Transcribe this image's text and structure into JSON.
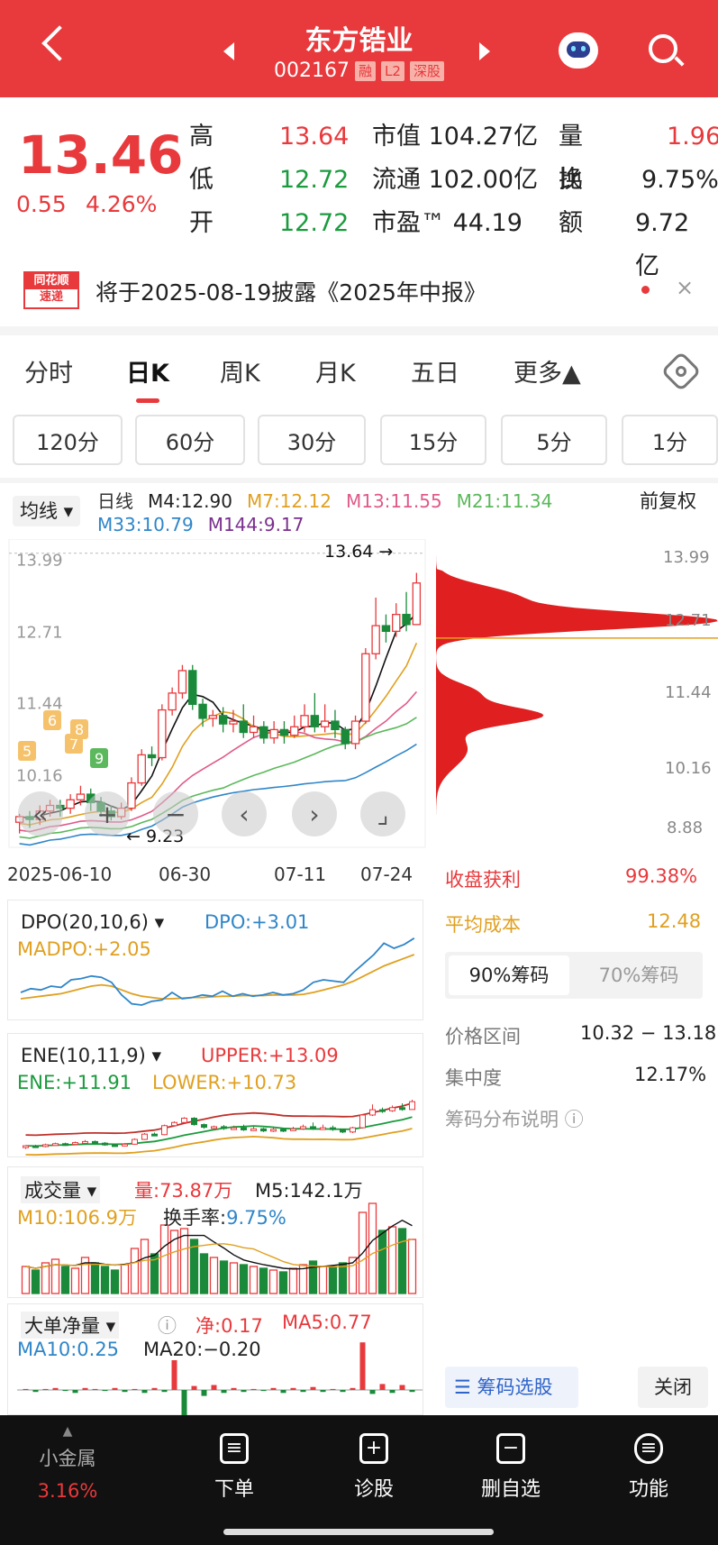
{
  "header": {
    "title": "东方锆业",
    "code": "002167",
    "tags": [
      "融",
      "L2",
      "深股"
    ]
  },
  "quote": {
    "price": "13.46",
    "change": "0.55",
    "pct": "4.26%",
    "rows": [
      {
        "k1": "高",
        "v1": "13.64",
        "k2": "市值",
        "v2": "104.27亿",
        "k3": "量比",
        "v3": "1.96"
      },
      {
        "k1": "低",
        "v1": "12.72",
        "k2": "流通",
        "v2": "102.00亿",
        "k3": "换",
        "v3": "9.75%"
      },
      {
        "k1": "开",
        "v1": "12.72",
        "k2": "市盈™",
        "v2": "44.19",
        "k3": "额",
        "v3": "9.72亿"
      }
    ]
  },
  "notice": {
    "logo_top": "同花顺",
    "logo_bottom": "速递",
    "text": "将于2025-08-19披露《2025年中报》"
  },
  "tabs": [
    "分时",
    "日K",
    "周K",
    "月K",
    "五日",
    "更多▲"
  ],
  "intervals": [
    "120分",
    "60分",
    "30分",
    "15分",
    "5分",
    "1分"
  ],
  "ma": {
    "selector": "均线",
    "line1": [
      {
        "t": "日线",
        "c": "#333"
      },
      {
        "t": "M4:12.90",
        "c": "#222"
      },
      {
        "t": "M7:12.12",
        "c": "#e0a020"
      },
      {
        "t": "M13:11.55",
        "c": "#e05a8a"
      },
      {
        "t": "M21:11.34",
        "c": "#5cb85c"
      }
    ],
    "adjust": "前复权",
    "line2": [
      {
        "t": "M33:10.79",
        "c": "#2f86c9"
      },
      {
        "t": "M144:9.17",
        "c": "#7a2f8e"
      }
    ]
  },
  "chart_data": {
    "type": "candlestick",
    "dates": [
      "2025-06-10",
      "06-30",
      "07-11",
      "07-24"
    ],
    "y_ticks": [
      "13.99",
      "12.71",
      "11.44",
      "10.16",
      "8.88"
    ],
    "high_marker": "13.64",
    "low_marker": "9.23",
    "markers": [
      "6",
      "7",
      "8",
      "9",
      "5"
    ],
    "candles": [
      [
        9.2,
        9.3,
        9.0,
        9.35
      ],
      [
        9.3,
        9.25,
        9.1,
        9.4
      ],
      [
        9.25,
        9.4,
        9.15,
        9.5
      ],
      [
        9.4,
        9.5,
        9.3,
        9.6
      ],
      [
        9.5,
        9.45,
        9.3,
        9.6
      ],
      [
        9.45,
        9.6,
        9.35,
        9.7
      ],
      [
        9.6,
        9.7,
        9.5,
        9.85
      ],
      [
        9.7,
        9.55,
        9.4,
        9.8
      ],
      [
        9.55,
        9.4,
        9.3,
        9.65
      ],
      [
        9.4,
        9.3,
        9.23,
        9.5
      ],
      [
        9.3,
        9.45,
        9.25,
        9.55
      ],
      [
        9.45,
        9.9,
        9.4,
        10.0
      ],
      [
        9.9,
        10.4,
        9.85,
        10.5
      ],
      [
        10.4,
        10.35,
        10.2,
        10.55
      ],
      [
        10.35,
        11.2,
        10.3,
        11.3
      ],
      [
        11.2,
        11.5,
        11.1,
        11.6
      ],
      [
        11.5,
        11.9,
        11.4,
        12.0
      ],
      [
        11.9,
        11.3,
        11.2,
        12.0
      ],
      [
        11.3,
        11.05,
        10.9,
        11.4
      ],
      [
        11.05,
        11.1,
        10.9,
        11.2
      ],
      [
        11.1,
        10.95,
        10.8,
        11.25
      ],
      [
        10.95,
        11.0,
        10.8,
        11.2
      ],
      [
        11.0,
        10.8,
        10.7,
        11.3
      ],
      [
        10.8,
        10.9,
        10.7,
        11.1
      ],
      [
        10.9,
        10.7,
        10.6,
        11.0
      ],
      [
        10.7,
        10.85,
        10.6,
        11.0
      ],
      [
        10.85,
        10.75,
        10.6,
        11.0
      ],
      [
        10.75,
        10.9,
        10.7,
        11.1
      ],
      [
        10.9,
        11.1,
        10.8,
        11.3
      ],
      [
        11.1,
        10.9,
        10.8,
        11.5
      ],
      [
        10.9,
        11.0,
        10.8,
        11.3
      ],
      [
        11.0,
        10.85,
        10.7,
        11.2
      ],
      [
        10.85,
        10.6,
        10.5,
        10.9
      ],
      [
        10.6,
        11.0,
        10.5,
        11.1
      ],
      [
        11.0,
        12.2,
        10.95,
        12.3
      ],
      [
        12.2,
        12.7,
        12.1,
        13.2
      ],
      [
        12.7,
        12.6,
        12.4,
        12.9
      ],
      [
        12.6,
        12.9,
        12.5,
        13.1
      ],
      [
        12.9,
        12.72,
        12.6,
        13.3
      ],
      [
        12.72,
        13.46,
        12.72,
        13.64
      ]
    ]
  },
  "chips": {
    "profit_label": "收盘获利",
    "profit": "99.38%",
    "cost_label": "平均成本",
    "cost": "12.48",
    "tab1": "90%筹码",
    "tab2": "70%筹码",
    "range_label": "价格区间",
    "range": "10.32 − 13.18",
    "conc_label": "集中度",
    "conc": "12.17%",
    "explain": "筹码分布说明 ⓘ",
    "select": "筹码选股",
    "close": "关闭"
  },
  "dpo": {
    "name": "DPO(20,10,6)",
    "dpo": "DPO:+3.01",
    "madpo": "MADPO:+2.05"
  },
  "ene": {
    "name": "ENE(10,11,9)",
    "upper": "UPPER:+13.09",
    "ene": "ENE:+11.91",
    "lower": "LOWER:+10.73"
  },
  "vol": {
    "name": "成交量",
    "liang": "量:73.87万",
    "m5": "M5:142.1万",
    "m10": "M10:106.9万",
    "hs_label": "换手率:",
    "hs": "9.75%"
  },
  "big": {
    "name": "大单净量",
    "net": "净:0.17",
    "ma5": "MA5:0.77",
    "ma10": "MA10:0.25",
    "ma20": "MA20:−0.20"
  },
  "bottom": {
    "sector": "小金属",
    "sector_pct": "3.16%",
    "items": [
      "下单",
      "诊股",
      "删自选",
      "功能"
    ]
  }
}
